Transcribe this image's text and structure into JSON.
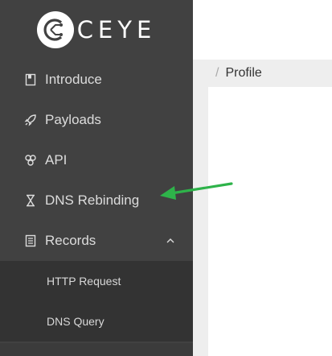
{
  "logo": {
    "text": "CEYE"
  },
  "nav": {
    "items": [
      {
        "label": "Introduce",
        "icon": "book-icon"
      },
      {
        "label": "Payloads",
        "icon": "rocket-icon"
      },
      {
        "label": "API",
        "icon": "api-icon"
      },
      {
        "label": "DNS Rebinding",
        "icon": "hourglass-icon"
      },
      {
        "label": "Records",
        "icon": "records-icon",
        "expanded": true
      }
    ],
    "records_submenu": [
      {
        "label": "HTTP Request"
      },
      {
        "label": "DNS Query"
      }
    ]
  },
  "breadcrumb": {
    "separator": "/",
    "current": "Profile"
  },
  "colors": {
    "sidebar_bg": "#414141",
    "submenu_bg": "#333333",
    "arrow": "#2eb34a"
  }
}
